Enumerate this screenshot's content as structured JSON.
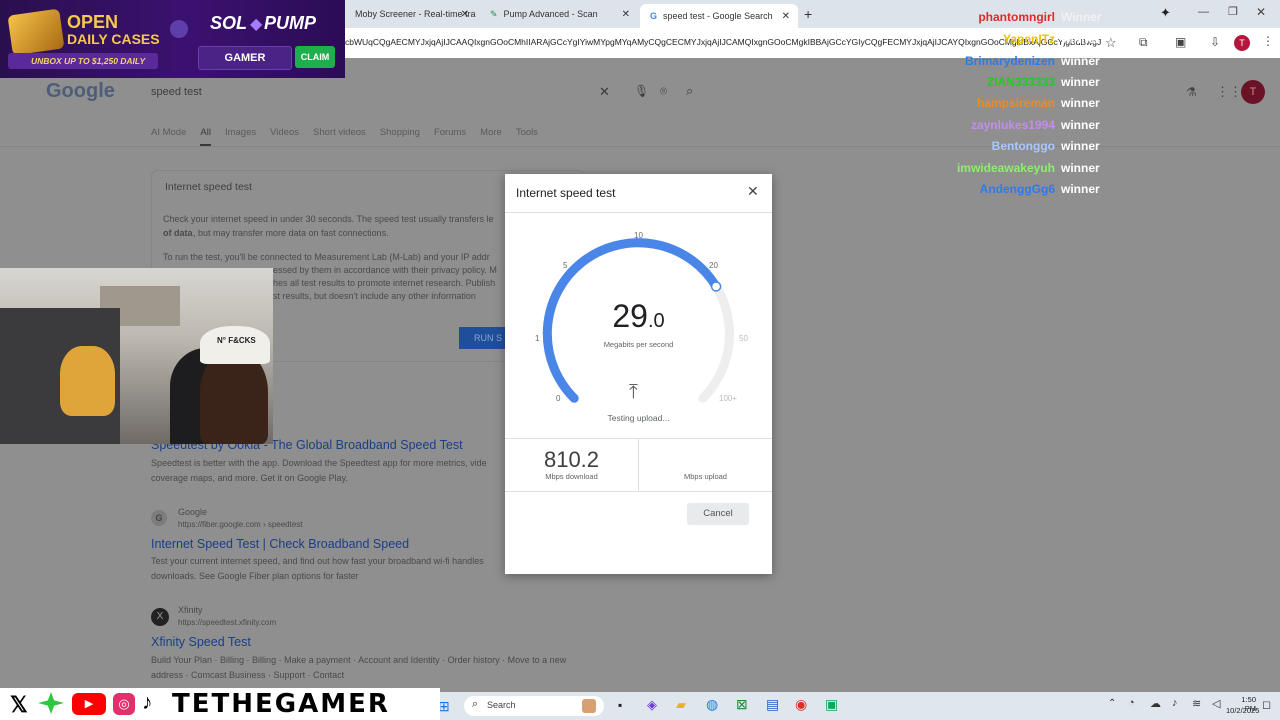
{
  "browser": {
    "tabs": [
      {
        "label": "Moby Screener - Real-time tra"
      },
      {
        "label": "Pump Advanced - Scan"
      },
      {
        "label": "speed test - Google Search"
      }
    ],
    "url": "cbWUqCQgAECMYJxjqAjIJCAAQIxgnGOoCMhIIARAjGCcYgIYiwMYpgMYqAMyCQgCECMYJxjqAjIJCAMQIxgnGOoCMgkIBBAjGCcYGIyCQgFECMYJxjqAjIJCAYQIxgnGOoCMgkIBxAjGCcYjgBdBwgJ"
  },
  "google": {
    "logo": "Google",
    "search_value": "speed test",
    "filters": [
      "AI Mode",
      "All",
      "Images",
      "Videos",
      "Short videos",
      "Shopping",
      "Forums",
      "More",
      "Tools"
    ],
    "speedbox_title": "Internet speed test",
    "speedbox_text1": "Check your internet speed in under 30 seconds. The speed test usually transfers le",
    "speedbox_text2": "of data",
    "speedbox_text3": ", but may transfer more data on fast connections.",
    "speedbox_text4": "To run the test, you'll be connected to Measurement Lab (M-Lab) and your IP addr",
    "speedbox_text5": "essed by them in accordance with their privacy policy. M",
    "speedbox_text6": "hes all test results to promote internet research. Publish",
    "speedbox_text7": "st results, but doesn't include any other information",
    "run_button": "RUN S",
    "result1_title": "Speedtest by Ookla - The Global Broadband Speed Test",
    "result1_desc1": "Speedtest is better with the app. Download the Speedtest app for more metrics, vide",
    "result1_desc2": "coverage maps, and more. Get it on Google Play.",
    "result2_source": "Google",
    "result2_url": "https://fiber.google.com › speedtest",
    "result2_title": "Internet Speed Test | Check Broadband Speed",
    "result2_desc1": "Test your current internet speed, and find out how fast your broadband wi-fi handles",
    "result2_desc2": "downloads. See Google Fiber plan options for faster",
    "result3_source": "Xfinity",
    "result3_url": "https://speedtest.xfinity.com",
    "result3_title": "Xfinity Speed Test",
    "result3_desc1": "Build Your Plan · Billing · Billing · Make a payment · Account and Identity · Order history · Move to a new",
    "result3_desc2": "address · Comcast Business · Support · Contact"
  },
  "promo": {
    "line1": "OPEN",
    "line2": "DAILY CASES",
    "line3": "UNBOX UP TO $1,250 DAILY",
    "brand": "SOL",
    "brand2": "PUMP",
    "code": "GAMER",
    "claim": "CLAIM"
  },
  "cam": {
    "hat_text": "N° F&CKS"
  },
  "chat": [
    {
      "name": "phantomngirl",
      "status": "Winner",
      "color": "#e02a2a"
    },
    {
      "name": "YapenITz",
      "status": "winner",
      "color": "#e8c20b"
    },
    {
      "name": "Brimarydenizen",
      "status": "winner",
      "color": "#2e7be8"
    },
    {
      "name": "ZIAN333333",
      "status": "winner",
      "color": "#22c922"
    },
    {
      "name": "hampsireman",
      "status": "winner",
      "color": "#f08a1e"
    },
    {
      "name": "zaynlukes1994",
      "status": "winner",
      "color": "#c58cf0"
    },
    {
      "name": "Bentonggo",
      "status": "winner",
      "color": "#a8c8ff"
    },
    {
      "name": "imwideawakeyuh",
      "status": "winner",
      "color": "#8cf06a"
    },
    {
      "name": "AndenggGg6",
      "status": "winner",
      "color": "#2e7be8"
    }
  ],
  "dialog": {
    "title": "Internet speed test",
    "gauge_ticks": [
      "0",
      "1",
      "5",
      "10",
      "20",
      "50",
      "100+"
    ],
    "speed_int": "29",
    "speed_dec": ".0",
    "speed_unit": "Megabits per second",
    "status": "Testing upload...",
    "download_value": "810.2",
    "download_label": "Mbps download",
    "upload_value": "",
    "upload_label": "Mbps upload",
    "cancel": "Cancel",
    "accent": "#4a86e8"
  },
  "taskbar": {
    "brand_name": "TETHEGAMER",
    "search_placeholder": "Search",
    "time": "1:50 PM",
    "date": "10/2/2025"
  }
}
